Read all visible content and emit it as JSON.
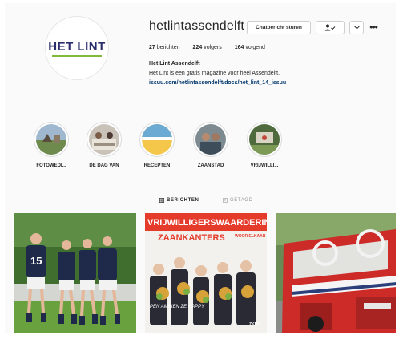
{
  "profile": {
    "username": "hetlintassendelft",
    "avatar_logo": "HET LINT",
    "message_button": "Chatbericht sturen",
    "following_icon": "person-check-icon",
    "more_label": "•••",
    "stats": {
      "posts_count": "27",
      "posts_label": "berichten",
      "followers_count": "224",
      "followers_label": "volgers",
      "following_count": "164",
      "following_label": "volgend"
    },
    "full_name": "Het Lint Assendelft",
    "bio": "Het Lint is een gratis magazine voor heel Assendelft.",
    "link": "issuu.com/hetlintassendelft/docs/het_lint_14_issuu"
  },
  "highlights": [
    {
      "label": "FOTOWEDI..."
    },
    {
      "label": "DE DAG VAN"
    },
    {
      "label": "RECEPTEN"
    },
    {
      "label": "ZAANSTAD"
    },
    {
      "label": "VRIJWILLI..."
    }
  ],
  "tabs": [
    {
      "label": "BERICHTEN",
      "icon": "grid-icon",
      "active": true
    },
    {
      "label": "GETAGD",
      "icon": "tag-icon",
      "active": false
    }
  ],
  "posts": [
    {
      "subject": "football-players",
      "jersey_number": "15"
    },
    {
      "subject": "volunteers-poster",
      "headline_1": "VRIJWILLIGERSWAARDERING",
      "headline_2": "ZAANKANTERS",
      "badge": "WOOR ELKAAR",
      "handwriting": "PEN AMBIEN ZE HAPPY",
      "logo_tag": "ZKNT"
    },
    {
      "subject": "red-vintage-bus"
    }
  ],
  "colors": {
    "link": "#00376b",
    "logo_navy": "#2c2f6e",
    "logo_green": "#7fba3a",
    "poster_red": "#e53b2b"
  }
}
